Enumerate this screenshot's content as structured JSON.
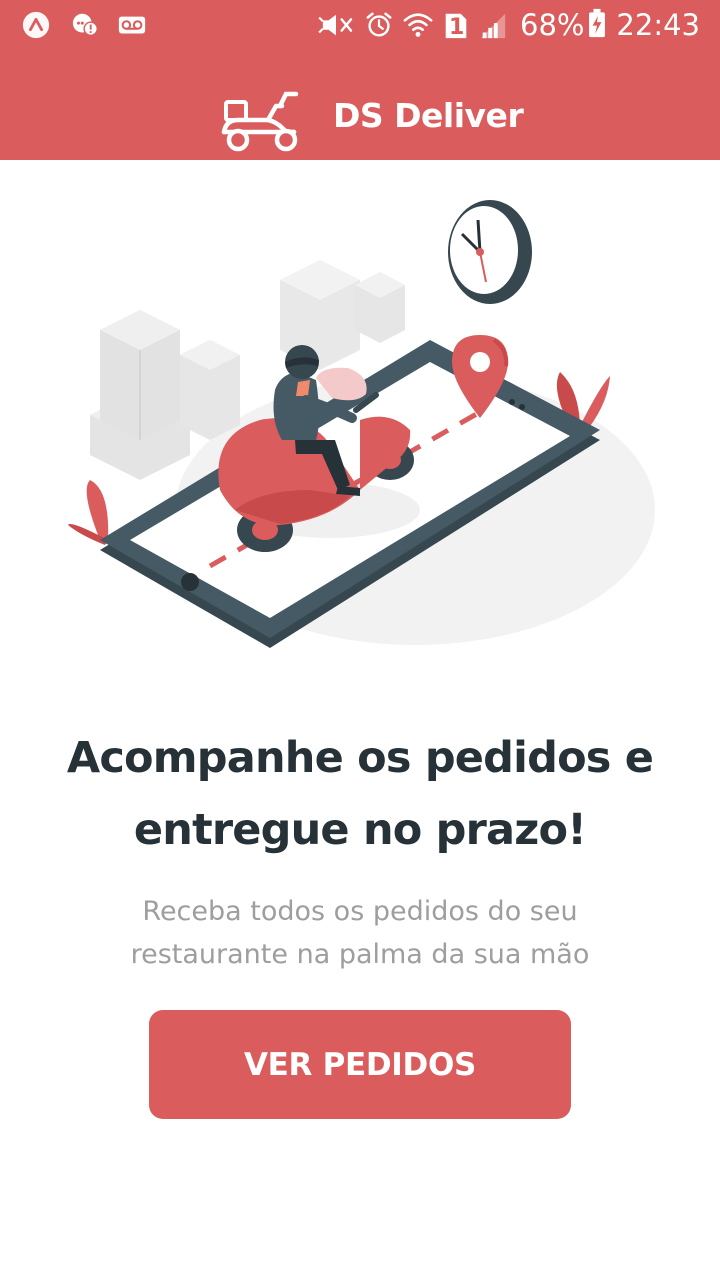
{
  "status_bar": {
    "battery_percent": "68%",
    "time": "22:43",
    "sim_slot": "1",
    "icons": [
      "app-launcher-icon",
      "chat-bubble-alert-icon",
      "voicemail-icon",
      "vibrate-mute-icon",
      "alarm-clock-icon",
      "wifi-icon",
      "sim-icon",
      "cell-signal-icon",
      "battery-charging-icon"
    ]
  },
  "header": {
    "title": "DS Deliver",
    "logo_icon": "delivery-scooter-icon"
  },
  "hero": {
    "headline": "Acompanhe os pedidos e entregue no prazo!",
    "subtitle": "Receba todos os pedidos do seu restaurante na palma da sua mão"
  },
  "actions": {
    "primary_label": "VER PEDIDOS"
  },
  "colors": {
    "primary": "#da5c5c",
    "heading": "#263238",
    "body_text": "#9e9e9e",
    "background": "#ffffff"
  }
}
